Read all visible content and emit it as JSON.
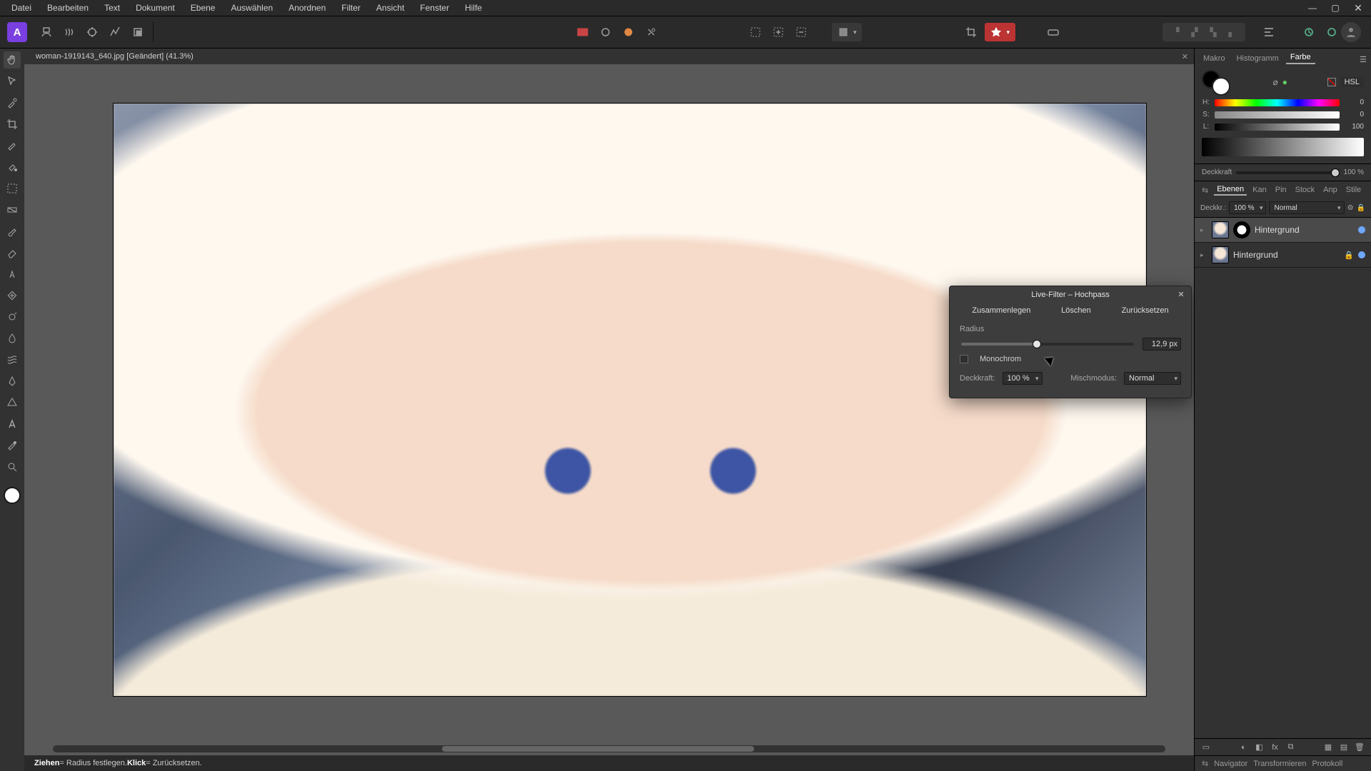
{
  "menubar": {
    "items": [
      "Datei",
      "Bearbeiten",
      "Text",
      "Dokument",
      "Ebene",
      "Auswählen",
      "Anordnen",
      "Filter",
      "Ansicht",
      "Fenster",
      "Hilfe"
    ]
  },
  "document": {
    "tab_title": "woman-1919143_640.jpg [Geändert] (41.3%)"
  },
  "statusbar": {
    "t1": "Ziehen",
    "t2": " = Radius festlegen. ",
    "t3": "Klick",
    "t4": " = Zurücksetzen."
  },
  "dialog": {
    "title": "Live-Filter – Hochpass",
    "merge": "Zusammenlegen",
    "delete": "Löschen",
    "reset": "Zurücksetzen",
    "radius_label": "Radius",
    "radius_value": "12,9 px",
    "mono_label": "Monochrom",
    "opacity_label": "Deckkraft:",
    "opacity_value": "100 %",
    "blend_label": "Mischmodus:",
    "blend_value": "Normal"
  },
  "rightpanel": {
    "tabs": {
      "makro": "Makro",
      "histogramm": "Histogramm",
      "farbe": "Farbe"
    },
    "color_mode": "HSL",
    "hsl": {
      "h": "0",
      "s": "0",
      "l": "100"
    },
    "deck_label": "Deckkraft",
    "deck_value": "100 %",
    "layer_tabs": [
      "Ebenen",
      "Kan",
      "Pin",
      "Stock",
      "Anp",
      "Stile"
    ],
    "layer_opacity_label": "Deckkr.:",
    "layer_opacity_value": "100 %",
    "blend_value": "Normal",
    "layers": [
      {
        "name": "Hintergrund",
        "mask": true,
        "visible": true,
        "locked": false
      },
      {
        "name": "Hintergrund",
        "mask": false,
        "visible": true,
        "locked": true
      }
    ],
    "bottom_tabs": [
      "Navigator",
      "Transformieren",
      "Protokoll"
    ]
  }
}
